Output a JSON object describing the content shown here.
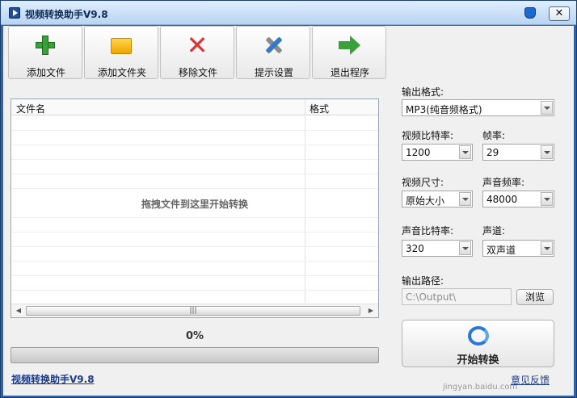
{
  "window": {
    "title": "视频转换助手V9.8",
    "close_glyph": "✕"
  },
  "toolbar": {
    "add_file": "添加文件",
    "add_folder": "添加文件夹",
    "remove_file": "移除文件",
    "tips_settings": "提示设置",
    "exit_program": "退出程序"
  },
  "file_list": {
    "columns": [
      "文件名",
      "格式"
    ],
    "drop_hint": "拖拽文件到这里开始转换",
    "rows": []
  },
  "progress": {
    "text": "0%",
    "value": 0
  },
  "settings": {
    "output_format": {
      "label": "输出格式:",
      "value": "MP3(纯音频格式)"
    },
    "video_bitrate": {
      "label": "视频比特率:",
      "value": "1200"
    },
    "frame_rate": {
      "label": "帧率:",
      "value": "29"
    },
    "video_size": {
      "label": "视频尺寸:",
      "value": "原始大小"
    },
    "audio_sample_rate": {
      "label": "声音频率:",
      "value": "48000"
    },
    "audio_bitrate": {
      "label": "声音比特率:",
      "value": "320"
    },
    "channels": {
      "label": "声道:",
      "value": "双声道"
    },
    "output_path": {
      "label": "输出路径:",
      "value": "C:\\Output\\"
    },
    "browse": "浏览"
  },
  "start_button": {
    "label": "开始转换"
  },
  "footer": {
    "app_link": "视频转换助手V9.8",
    "feedback": "意见反馈"
  },
  "watermark": "jingyan.baidu.com",
  "colors": {
    "title_bar": "#c9def5",
    "frame": "#2f63a6",
    "link": "#1b3a8a",
    "accent": "#2a78d6"
  }
}
